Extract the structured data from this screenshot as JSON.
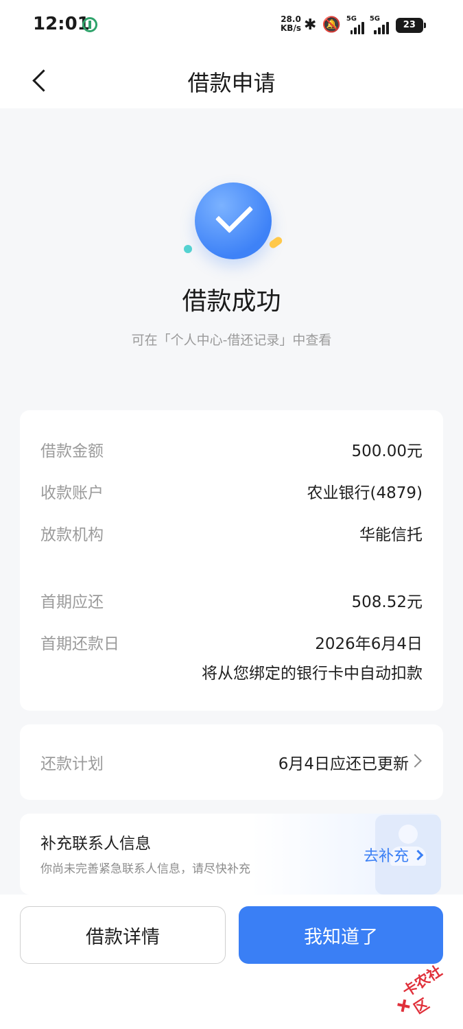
{
  "status_bar": {
    "time": "12:01",
    "net_speed_value": "28.0",
    "net_speed_unit": "KB/s",
    "signal_1_label": "5G",
    "signal_2_label": "5G",
    "battery": "23",
    "icons": [
      "bluetooth-icon",
      "bell-muted-icon",
      "signal-icon",
      "signal-icon",
      "battery-icon"
    ]
  },
  "nav": {
    "title": "借款申请",
    "back_icon": "chevron-left-icon"
  },
  "result": {
    "title": "借款成功",
    "hint": "可在「个人中心-借还记录」中查看",
    "icon": "check-circle-icon",
    "accent_color": "#3e82f7"
  },
  "details": [
    {
      "label": "借款金额",
      "value": "500.00元"
    },
    {
      "label": "收款账户",
      "value": "农业银行(4879)"
    },
    {
      "label": "放款机构",
      "value": "华能信托"
    },
    {
      "label": "首期应还",
      "value": "508.52元"
    },
    {
      "label": "首期还款日",
      "value": "2026年6月4日"
    }
  ],
  "details_note": "将从您绑定的银行卡中自动扣款",
  "plan": {
    "label": "还款计划",
    "value": "6月4日应还已更新"
  },
  "contact": {
    "title": "补充联系人信息",
    "subtitle": "你尚未完善紧急联系人信息，请尽快补充",
    "action": "去补充"
  },
  "buttons": {
    "detail": "借款详情",
    "ok": "我知道了",
    "primary_color": "#3a7ff5"
  },
  "watermark": "卡农社区"
}
